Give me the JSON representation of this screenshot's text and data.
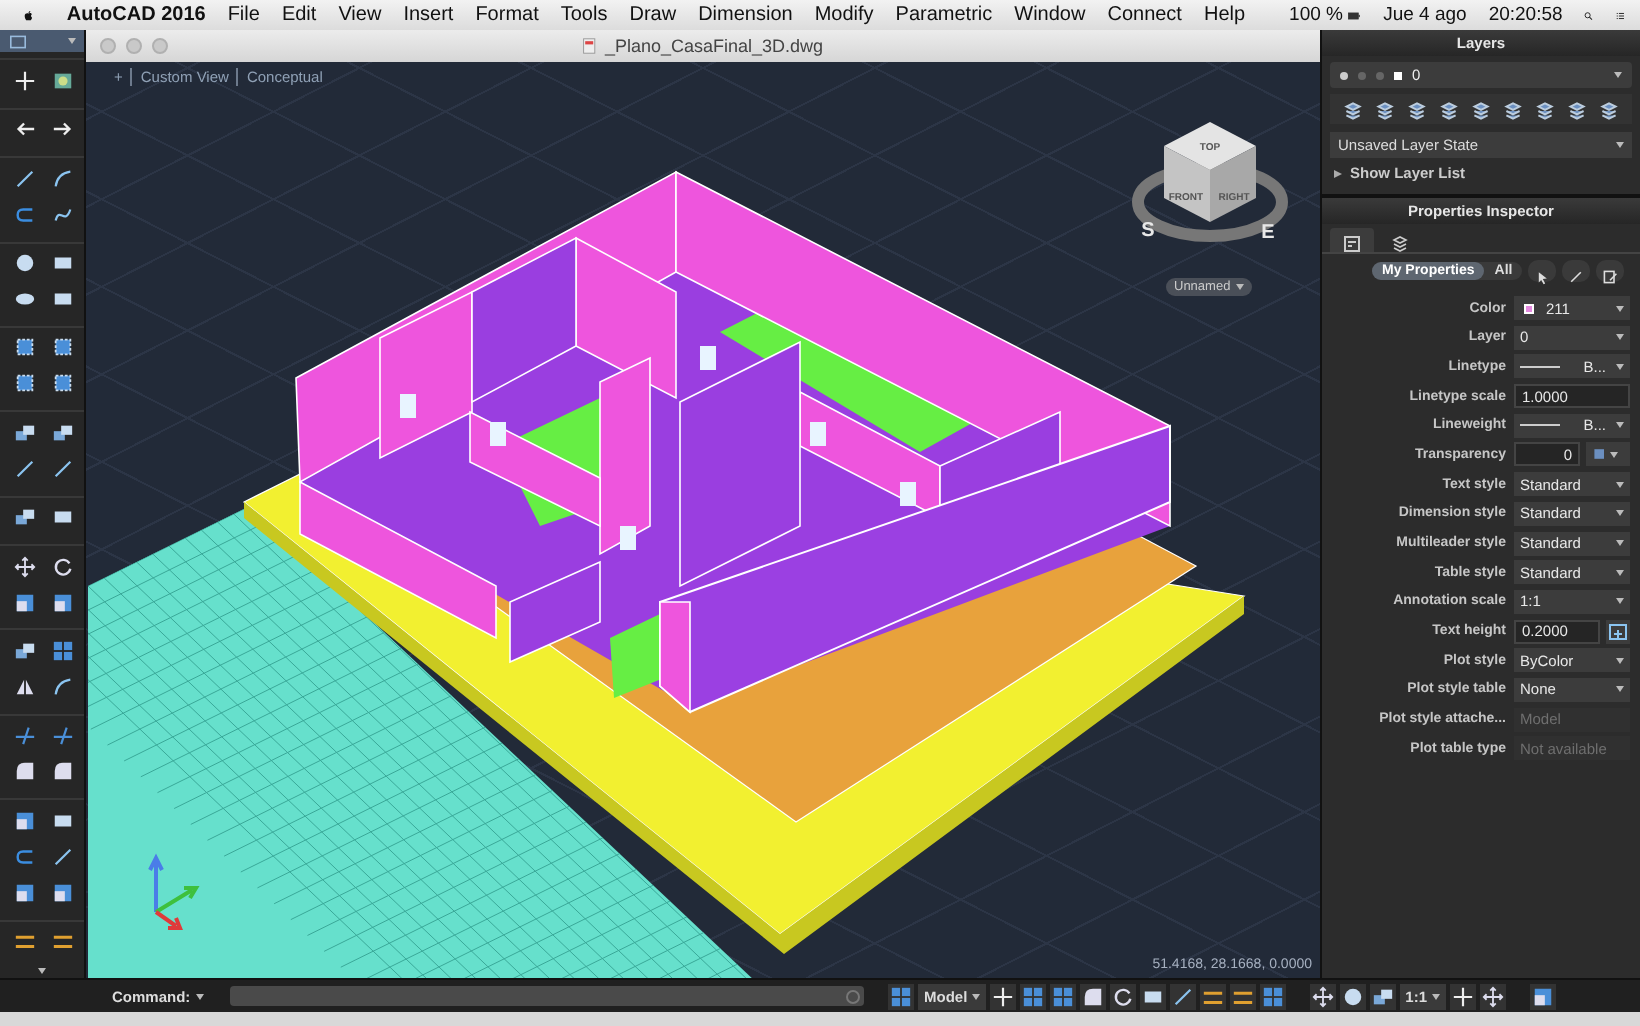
{
  "menu_bar": {
    "app_name": "AutoCAD 2016",
    "menus": [
      "File",
      "Edit",
      "View",
      "Insert",
      "Format",
      "Tools",
      "Draw",
      "Dimension",
      "Modify",
      "Parametric",
      "Window",
      "Connect",
      "Help"
    ],
    "battery": "100 %",
    "date": "Jue 4 ago",
    "time": "20:20:58"
  },
  "drawing_window": {
    "title": "_Plano_CasaFinal_3D.dwg",
    "viewport_controls": [
      "+",
      "Custom View",
      "Conceptual"
    ],
    "viewcube": {
      "faces": [
        "TOP",
        "FRONT",
        "RIGHT"
      ],
      "compass": [
        "S",
        "E"
      ],
      "view_name": "Unnamed"
    },
    "coordinates": "51.4168, 28.1668, 0.0000"
  },
  "command_line": {
    "label": "Command:"
  },
  "status_bar": {
    "model_button": "Model",
    "annotation_scale": "1:1"
  },
  "layers_panel": {
    "title": "Layers",
    "current_layer": "0",
    "layer_state": "Unsaved Layer State",
    "show_list": "Show Layer List"
  },
  "properties_inspector": {
    "title": "Properties Inspector",
    "filters": [
      {
        "label": "My Properties",
        "selected": true
      },
      {
        "label": "All",
        "selected": false
      }
    ],
    "rows": [
      {
        "label": "Color",
        "value": "211",
        "kind": "dropdown",
        "color": "#e58ae0"
      },
      {
        "label": "Layer",
        "value": "0",
        "kind": "dropdown"
      },
      {
        "label": "Linetype",
        "value": "B...",
        "kind": "line-dropdown"
      },
      {
        "label": "Linetype scale",
        "value": "1.0000",
        "kind": "input"
      },
      {
        "label": "Lineweight",
        "value": "B...",
        "kind": "line-dropdown"
      },
      {
        "label": "Transparency",
        "value": "0",
        "kind": "slider"
      },
      {
        "label": "Text style",
        "value": "Standard",
        "kind": "dropdown"
      },
      {
        "label": "Dimension style",
        "value": "Standard",
        "kind": "dropdown"
      },
      {
        "label": "Multileader style",
        "value": "Standard",
        "kind": "dropdown"
      },
      {
        "label": "Table style",
        "value": "Standard",
        "kind": "dropdown"
      },
      {
        "label": "Annotation scale",
        "value": "1:1",
        "kind": "dropdown"
      },
      {
        "label": "Text height",
        "value": "0.2000",
        "kind": "input-button"
      },
      {
        "label": "Plot style",
        "value": "ByColor",
        "kind": "dropdown"
      },
      {
        "label": "Plot style table",
        "value": "None",
        "kind": "dropdown"
      },
      {
        "label": "Plot style attache...",
        "value": "Model",
        "kind": "readonly"
      },
      {
        "label": "Plot table type",
        "value": "Not available",
        "kind": "readonly"
      }
    ]
  }
}
